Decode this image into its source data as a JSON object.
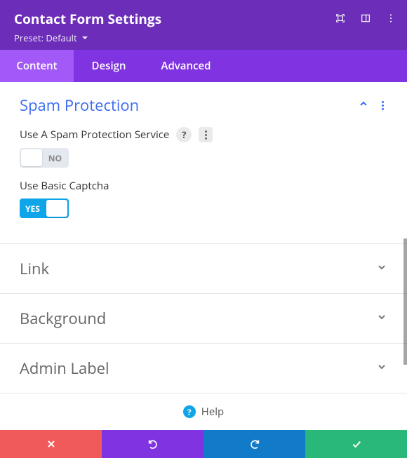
{
  "header": {
    "title": "Contact Form Settings",
    "preset_prefix": "Preset: ",
    "preset_name": "Default"
  },
  "tabs": {
    "content": "Content",
    "design": "Design",
    "advanced": "Advanced"
  },
  "sections": {
    "spam": {
      "title": "Spam Protection",
      "field1_label": "Use A Spam Protection Service",
      "field1_value": "NO",
      "field2_label": "Use Basic Captcha",
      "field2_value": "YES"
    },
    "link": {
      "title": "Link"
    },
    "background": {
      "title": "Background"
    },
    "admin_label": {
      "title": "Admin Label"
    }
  },
  "help": {
    "label": "Help"
  },
  "colors": {
    "header": "#6c2eb9",
    "tabsbg": "#8033e0",
    "active_tab": "#a259f7",
    "accent_blue": "#3d6cf2",
    "toggle_on": "#0ea5e9",
    "cancel": "#f05a5a",
    "save": "#2ab87a",
    "redo": "#117ac9"
  }
}
